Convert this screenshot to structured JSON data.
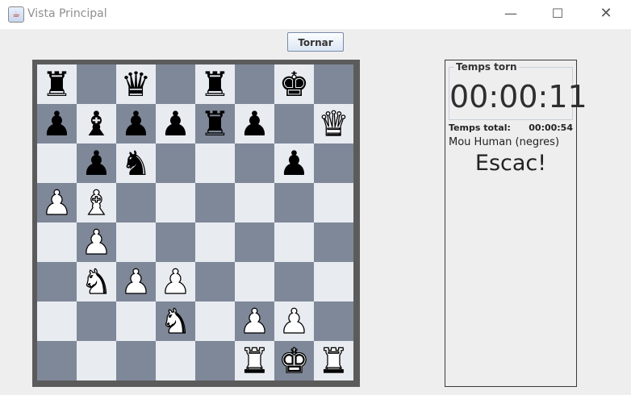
{
  "window": {
    "title": "Vista Principal",
    "minimize": "—",
    "maximize": "☐",
    "close": "✕"
  },
  "toolbar": {
    "tornar_label": "Tornar"
  },
  "board": {
    "rows": [
      [
        "r",
        "",
        "q",
        "",
        "r",
        "",
        "k",
        ""
      ],
      [
        "p",
        "b",
        "p",
        "p",
        "r",
        "p",
        "",
        "Q"
      ],
      [
        "",
        "p",
        "n",
        "",
        "",
        "",
        "p",
        ""
      ],
      [
        "P",
        "B",
        "",
        "",
        "",
        "",
        "",
        ""
      ],
      [
        "",
        "P",
        "",
        "",
        "",
        "",
        "",
        ""
      ],
      [
        "",
        "N",
        "P",
        "P",
        "",
        "",
        "",
        ""
      ],
      [
        "",
        "",
        "",
        "N",
        "",
        "P",
        "P",
        ""
      ],
      [
        "",
        "",
        "",
        "",
        "",
        "R",
        "K",
        "R"
      ]
    ]
  },
  "side_panel": {
    "turn_timer_label": "Temps torn",
    "turn_timer_value": "00:00:11",
    "total_time_label": "Temps total:",
    "total_time_value": "00:00:54",
    "turn_info": "Mou Human (negres)",
    "status": "Escac!"
  },
  "colors": {
    "light_square": "#e8ecf1",
    "dark_square": "#7f8899",
    "board_border": "#5b5b5b"
  }
}
